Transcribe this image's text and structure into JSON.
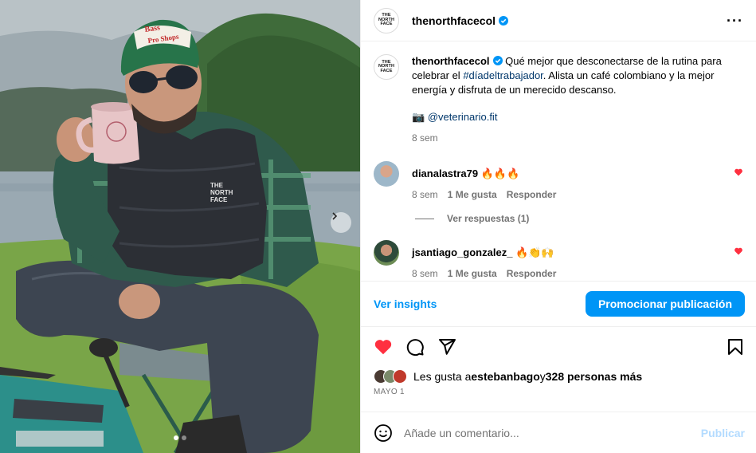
{
  "post": {
    "username": "thenorthfacecol",
    "more_icon": "more-horizontal-icon",
    "logo_text": [
      "THE",
      "NORTH",
      "FACE"
    ]
  },
  "caption": {
    "username": "thenorthfacecol",
    "text_before": " Qué mejor que desconectarse de la rutina para celebrar el ",
    "hashtag": "#díadeltrabajador",
    "text_after": ". Alista un café colombiano y la mejor energía y disfruta de un merecido descanso.",
    "credit_icon": "📷",
    "credit_link": "@veterinario.fit",
    "time": "8 sem"
  },
  "comments": [
    {
      "username": "dianalastra79",
      "text": "🔥🔥🔥",
      "time": "8 sem",
      "likes": "1 Me gusta",
      "reply": "Responder",
      "liked": true,
      "view_replies": "Ver respuestas (1)"
    },
    {
      "username": "jsantiago_gonzalez_",
      "text": "🔥👏🙌",
      "time": "8 sem",
      "likes": "1 Me gusta",
      "reply": "Responder",
      "liked": true
    }
  ],
  "insights": {
    "view_label": "Ver insights",
    "promote_label": "Promocionar publicación"
  },
  "actions": {
    "like_icon": "heart-filled-icon",
    "comment_icon": "comment-icon",
    "share_icon": "send-icon",
    "save_icon": "bookmark-icon"
  },
  "likes": {
    "prefix": "Les gusta a ",
    "user": "estebanbago",
    "middle": " y ",
    "count": "328 personas más"
  },
  "date": "MAYO 1",
  "add_comment": {
    "placeholder": "Añade un comentario...",
    "emoji_icon": "smiley-icon",
    "publish_label": "Publicar"
  },
  "carousel": {
    "current": 1,
    "total": 2
  },
  "colors": {
    "accent": "#0095f6",
    "heart": "#ff3040",
    "link": "#00376b",
    "muted": "#737373"
  }
}
